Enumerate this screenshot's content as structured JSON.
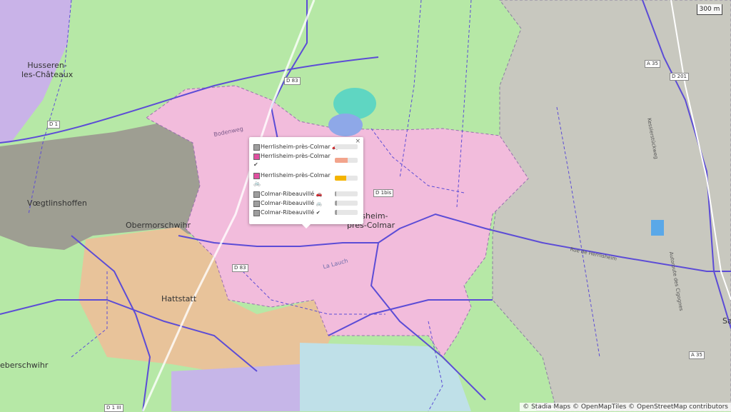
{
  "map": {
    "scale_label": "300 m",
    "attribution": "© Stadia Maps © OpenMapTiles © OpenStreetMap contributors",
    "places": {
      "husseren": "Husseren-\nles-Châteaux",
      "voegtlinshoffen": "Vœgtlinshoffen",
      "obermorschwihr": "Obermorschwihr",
      "hattstatt": "Hattstatt",
      "herrlisheim_town": "rlisheim-\nprès-Colmar",
      "eguisheim_partial": "eberschwihr",
      "right_partial": "Sa"
    },
    "streets": [
      "Bodenweg",
      "La Lauch",
      "Rue de Herrlisheim",
      "Autoroute des Cigognes",
      "Kessierstückweg"
    ],
    "roads": [
      "D 83",
      "D 1bis",
      "D 1",
      "D 201",
      "A 35",
      "D 1 III"
    ]
  },
  "popup": {
    "close": "×",
    "rows": [
      {
        "label": "Herrlisheim-près-Colmar",
        "mode": "car",
        "mode_icon": "🚗",
        "color": "#9e9e9e",
        "value": 0.0,
        "bar": "#bbbbbb"
      },
      {
        "label": "Herrlisheim-près-Colmar",
        "mode": "walk",
        "mode_icon": "✔",
        "color": "#e04fa0",
        "value": 0.55,
        "bar": "#f2a48c"
      },
      {
        "label": "Herrlisheim-près-Colmar",
        "mode": "bike",
        "mode_icon": "🚲",
        "color": "#e04fa0",
        "value": 0.5,
        "bar": "#f4b400"
      },
      {
        "label": "Colmar-Ribeauvillé",
        "mode": "car",
        "mode_icon": "🚗",
        "color": "#9e9e9e",
        "value": 0.05,
        "bar": "#9e9e9e"
      },
      {
        "label": "Colmar-Ribeauvillé",
        "mode": "bike",
        "mode_icon": "🚲",
        "color": "#9e9e9e",
        "value": 0.08,
        "bar": "#9e9e9e"
      },
      {
        "label": "Colmar-Ribeauvillé",
        "mode": "walk",
        "mode_icon": "✔",
        "color": "#9e9e9e",
        "value": 0.08,
        "bar": "#9e9e9e"
      }
    ]
  }
}
